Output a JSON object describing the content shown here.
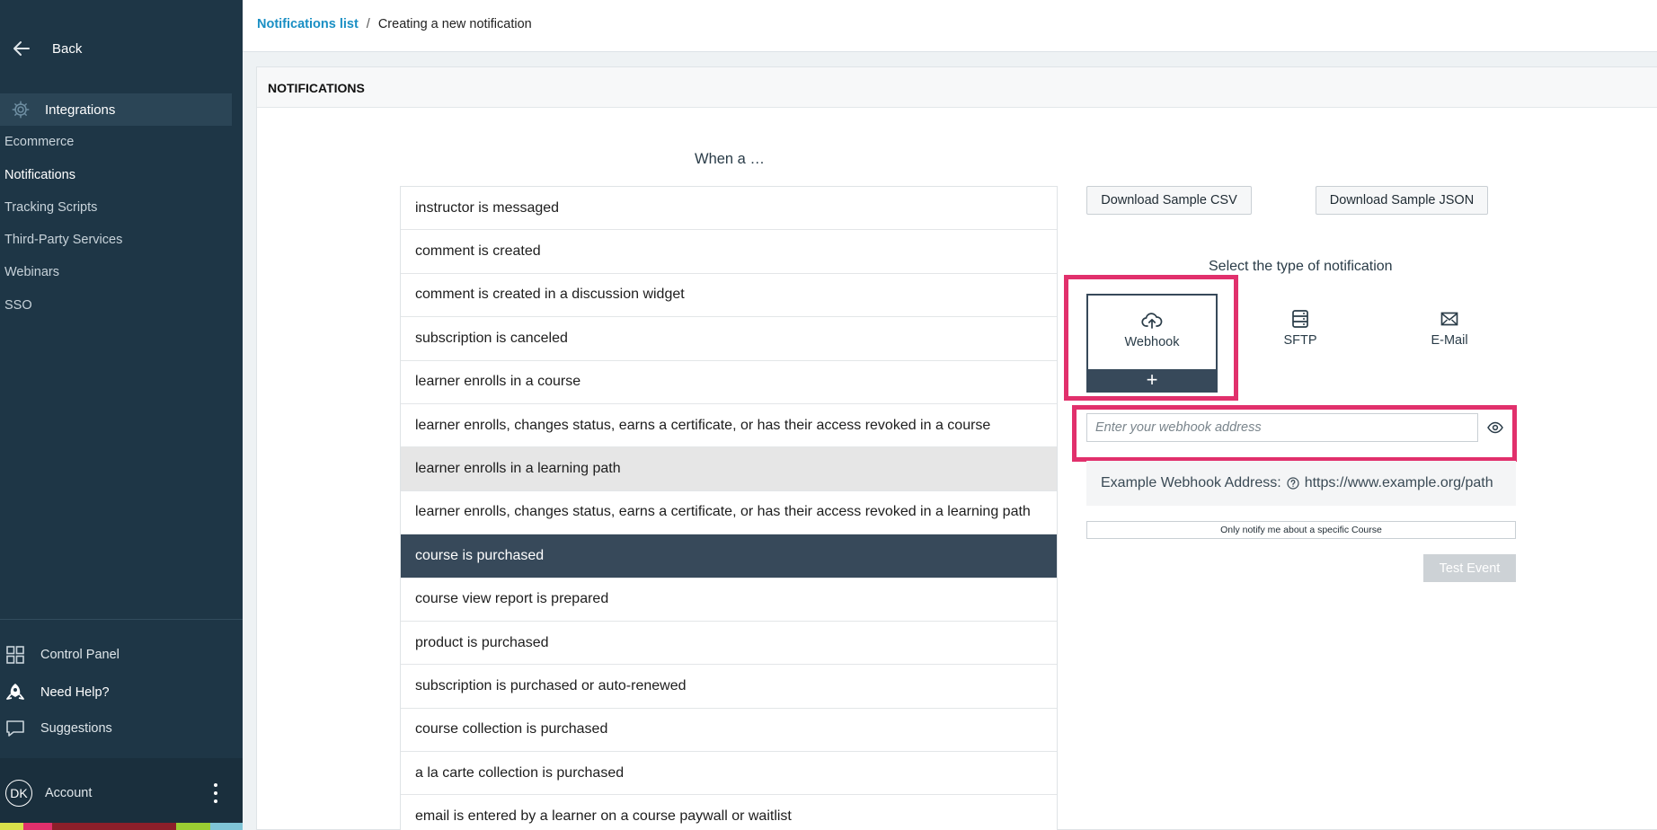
{
  "sidebar": {
    "back_label": "Back",
    "section_label": "Integrations",
    "items": [
      {
        "label": "Ecommerce",
        "active": false
      },
      {
        "label": "Notifications",
        "active": true
      },
      {
        "label": "Tracking Scripts",
        "active": false
      },
      {
        "label": "Third-Party Services",
        "active": false
      },
      {
        "label": "Webinars",
        "active": false
      },
      {
        "label": "SSO",
        "active": false
      }
    ],
    "bottom": {
      "control_panel": "Control Panel",
      "need_help": "Need Help?",
      "suggestions": "Suggestions"
    },
    "account": {
      "initials": "DK",
      "label": "Account"
    }
  },
  "breadcrumb": {
    "link": "Notifications list",
    "separator": "/",
    "current": "Creating a new notification"
  },
  "panel": {
    "title": "NOTIFICATIONS",
    "when_label": "When a …"
  },
  "events": [
    {
      "label": "instructor is messaged",
      "state": ""
    },
    {
      "label": "comment is created",
      "state": ""
    },
    {
      "label": "comment is created in a discussion widget",
      "state": ""
    },
    {
      "label": "subscription is canceled",
      "state": ""
    },
    {
      "label": "learner enrolls in a course",
      "state": ""
    },
    {
      "label": "learner enrolls, changes status, earns a certificate, or has their access revoked in a course",
      "state": ""
    },
    {
      "label": "learner enrolls in a learning path",
      "state": "hover"
    },
    {
      "label": "learner enrolls, changes status, earns a certificate, or has their access revoked in a learning path",
      "state": ""
    },
    {
      "label": "course is purchased",
      "state": "selected"
    },
    {
      "label": "course view report is prepared",
      "state": ""
    },
    {
      "label": "product is purchased",
      "state": ""
    },
    {
      "label": "subscription is purchased or auto-renewed",
      "state": ""
    },
    {
      "label": "course collection is purchased",
      "state": ""
    },
    {
      "label": "a la carte collection is purchased",
      "state": ""
    },
    {
      "label": "email is entered by a learner on a course paywall or waitlist",
      "state": ""
    }
  ],
  "actions": {
    "download_csv": "Download Sample CSV",
    "download_json": "Download Sample JSON",
    "select_type": "Select the type of notification",
    "types": [
      {
        "label": "Webhook",
        "icon": "cloud-upload-icon",
        "selected": true
      },
      {
        "label": "SFTP",
        "icon": "server-icon",
        "selected": false
      },
      {
        "label": "E-Mail",
        "icon": "envelope-icon",
        "selected": false
      }
    ],
    "add_symbol": "+",
    "webhook_placeholder": "Enter your webhook address",
    "webhook_value": "",
    "example_label": "Example Webhook Address:",
    "example_url": "https://www.example.org/path",
    "specific_course": "Only notify me about a specific Course",
    "test_event": "Test Event"
  },
  "colors": {
    "sidebar_bg": "#1e3646",
    "selected_row": "#37495a",
    "link": "#1a8fc4",
    "highlight": "#e1306c",
    "strip": [
      "#e1306c",
      "#8c1f2a",
      "#e1306c",
      "#9acd32",
      "#7fc4d6"
    ]
  }
}
